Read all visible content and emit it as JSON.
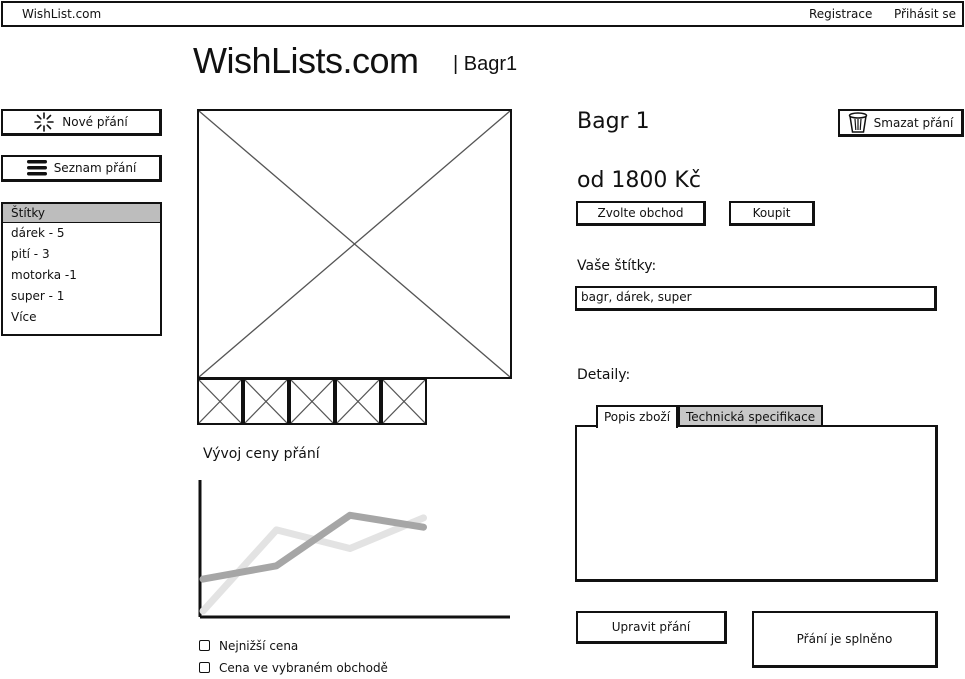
{
  "topbar": {
    "brand": "WishList.com",
    "register": "Registrace",
    "login": "Přihásit se"
  },
  "header": {
    "title": "WishLists.com",
    "subtitle": "| Bagr1"
  },
  "sidebar": {
    "new_wish": "Nové přání",
    "wish_list": "Seznam přání",
    "tags_header": "Štítky",
    "tags": [
      "dárek - 5",
      "pití - 3",
      "motorka -1",
      "super - 1",
      "Více"
    ]
  },
  "chart": {
    "title": "Vývoj ceny přání",
    "legend": [
      "Nejnižší cena",
      "Cena ve vybraném obchodě"
    ]
  },
  "chart_data": {
    "type": "line",
    "title": "Vývoj ceny přání",
    "xlabel": "",
    "ylabel": "",
    "x": [
      0,
      1,
      2,
      3,
      4
    ],
    "ylim": [
      0,
      10
    ],
    "series": [
      {
        "name": "Nejnižší cena",
        "values": [
          0.3,
          6.4,
          5.0,
          7.3,
          null
        ],
        "color": "#e3e3e3"
      },
      {
        "name": "Cena ve vybraném obchodě",
        "values": [
          2.7,
          3.7,
          7.5,
          6.6,
          null
        ],
        "color": "#a6a6a6"
      }
    ],
    "grid": false
  },
  "product": {
    "name": "Bagr 1",
    "delete": "Smazat přání",
    "price": "od 1800 Kč",
    "choose_shop": "Zvolte obchod",
    "buy": "Koupit",
    "your_tags_label": "Vaše štítky:",
    "your_tags_value": "bagr, dárek, super",
    "details_label": "Detaily:",
    "tabs": [
      "Popis zboží",
      "Technická specifikace"
    ],
    "edit": "Upravit přání",
    "fulfilled": "Přání je splněno"
  },
  "colors": {
    "tag_header": "#bdbdbd",
    "chart_line_dark": "#a6a6a6",
    "chart_line_light": "#e3e3e3",
    "tab_inactive": "#c8c8c8"
  }
}
